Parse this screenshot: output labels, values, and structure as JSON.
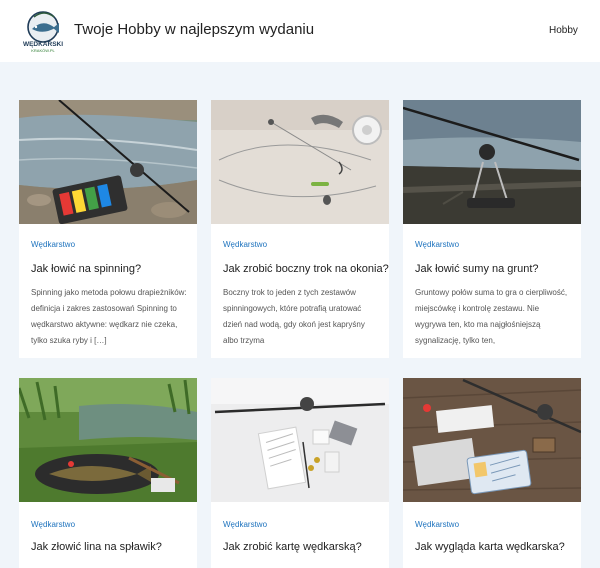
{
  "header": {
    "logo_text": "WĘDKARSKI",
    "logo_subtext": "KRAKÓW.PL",
    "site_title": "Twoje Hobby w najlepszym wydaniu",
    "nav": [
      {
        "label": "Hobby"
      }
    ]
  },
  "posts": [
    {
      "image": "river-spinning-lure-box",
      "category": "Wędkarstwo",
      "title": "Jak łowić na spinning?",
      "excerpt": "Spinning jako metoda połowu drapieżników: definicja i zakres zastosowań Spinning to wędkarstwo aktywne: wędkarz nie czeka, tylko szuka ryby i […]"
    },
    {
      "image": "drop-shot-rig-on-table",
      "category": "Wędkarstwo",
      "title": "Jak zrobić boczny trok na okonia?",
      "excerpt": "Boczny trok to jeden z tych zestawów spinningowych, które potrafią uratować dzień nad wodą, gdy okoń jest kapryśny albo trzyma"
    },
    {
      "image": "catfish-rod-at-dusk",
      "category": "Wędkarstwo",
      "title": "Jak łowić sumy na grunt?",
      "excerpt": "Gruntowy połów suma to gra o cierpliwość, miejscówkę i kontrolę zestawu. Nie wygrywa ten, kto ma najgłośniejszą sygnalizację, tylko ten,"
    },
    {
      "image": "tench-on-landing-net",
      "category": "Wędkarstwo",
      "title": "Jak złowić lina na spławik?",
      "excerpt": ""
    },
    {
      "image": "fishing-card-documents",
      "category": "Wędkarstwo",
      "title": "Jak zrobić kartę wędkarską?",
      "excerpt": ""
    },
    {
      "image": "fishing-license-on-desk",
      "category": "Wędkarstwo",
      "title": "Jak wygląda karta wędkarska?",
      "excerpt": ""
    }
  ],
  "colors": {
    "page_bg": "#f0f5fa",
    "category_link": "#1e73be",
    "title_text": "#222222"
  }
}
